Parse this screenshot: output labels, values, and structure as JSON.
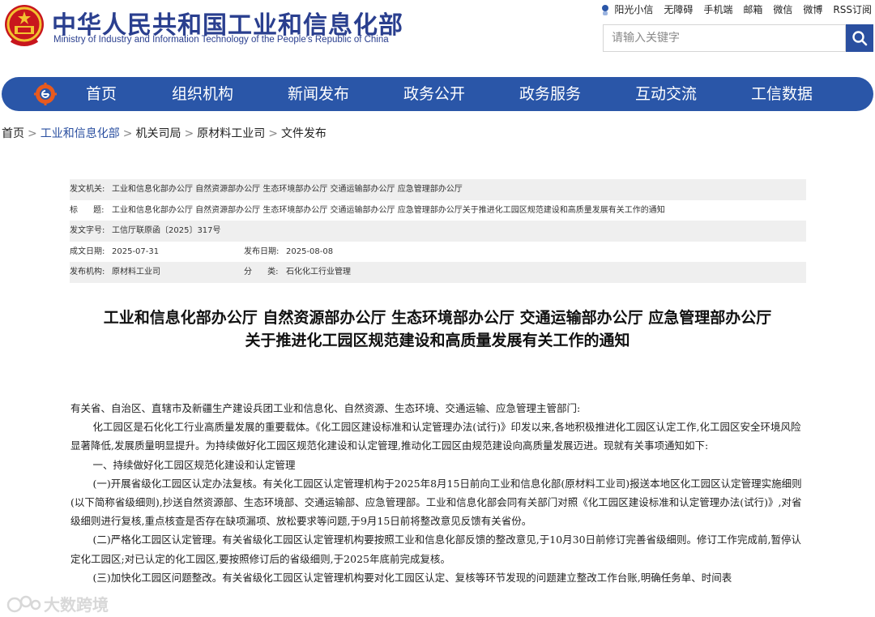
{
  "header": {
    "title": "中华人民共和国工业和信息化部",
    "subtitle": "Ministry of Industry and Information Technology of the People's Republic of China",
    "toplinks": [
      "阳光小信",
      "无障碍",
      "手机端",
      "邮箱",
      "微信",
      "微博",
      "RSS订阅"
    ],
    "search_placeholder": "请输入关键字"
  },
  "nav": {
    "items": [
      "首页",
      "组织机构",
      "新闻发布",
      "政务公开",
      "政务服务",
      "互动交流",
      "工信数据"
    ]
  },
  "breadcrumb": [
    "首页",
    "工业和信息化部",
    "机关司局",
    "原材料工业司",
    "文件发布"
  ],
  "meta": {
    "issuer_label": "发文机关:",
    "issuer": "工业和信息化部办公厅 自然资源部办公厅 生态环境部办公厅 交通运输部办公厅 应急管理部办公厅",
    "title_label": "标      题:",
    "title": "工业和信息化部办公厅 自然资源部办公厅 生态环境部办公厅 交通运输部办公厅 应急管理部办公厅关于推进化工园区规范建设和高质量发展有关工作的通知",
    "docno_label": "发文字号:",
    "docno": "工信厅联原函〔2025〕317号",
    "created_label": "成文日期:",
    "created": "2025-07-31",
    "published_label": "发布日期:",
    "published": "2025-08-08",
    "org_label": "发布机构:",
    "org": "原材料工业司",
    "category_label": "分      类:",
    "category": "石化化工行业管理"
  },
  "document": {
    "title_line1": "工业和信息化部办公厅 自然资源部办公厅 生态环境部办公厅 交通运输部办公厅 应急管理部办公厅",
    "title_line2": "关于推进化工园区规范建设和高质量发展有关工作的通知",
    "salutation": "有关省、自治区、直辖市及新疆生产建设兵团工业和信息化、自然资源、生态环境、交通运输、应急管理主管部门:",
    "para1": "化工园区是石化化工行业高质量发展的重要载体。《化工园区建设标准和认定管理办法(试行)》印发以来,各地积极推进化工园区认定工作,化工园区安全环境风险显著降低,发展质量明显提升。为持续做好化工园区规范化建设和认定管理,推动化工园区由规范建设向高质量发展迈进。现就有关事项通知如下:",
    "heading1": "一、持续做好化工园区规范化建设和认定管理",
    "para2": "(一)开展省级化工园区认定办法复核。有关化工园区认定管理机构于2025年8月15日前向工业和信息化部(原材料工业司)报送本地区化工园区认定管理实施细则(以下简称省级细则),抄送自然资源部、生态环境部、交通运输部、应急管理部。工业和信息化部会同有关部门对照《化工园区建设标准和认定管理办法(试行)》,对省级细则进行复核,重点核查是否存在缺项漏项、放松要求等问题,于9月15日前将整改意见反馈有关省份。",
    "para3": "(二)严格化工园区认定管理。有关省级化工园区认定管理机构要按照工业和信息化部反馈的整改意见,于10月30日前修订完善省级细则。修订工作完成前,暂停认定化工园区;对已认定的化工园区,要按照修订后的省级细则,于2025年底前完成复核。",
    "para4": "(三)加快化工园区问题整改。有关省级化工园区认定管理机构要对化工园区认定、复核等环节发现的问题建立整改工作台账,明确任务单、时间表"
  },
  "watermark": "大数跨境",
  "colors": {
    "brand_blue": "#2a56a8",
    "title_blue": "#2a3f8f",
    "meta_shade": "#efefef"
  }
}
